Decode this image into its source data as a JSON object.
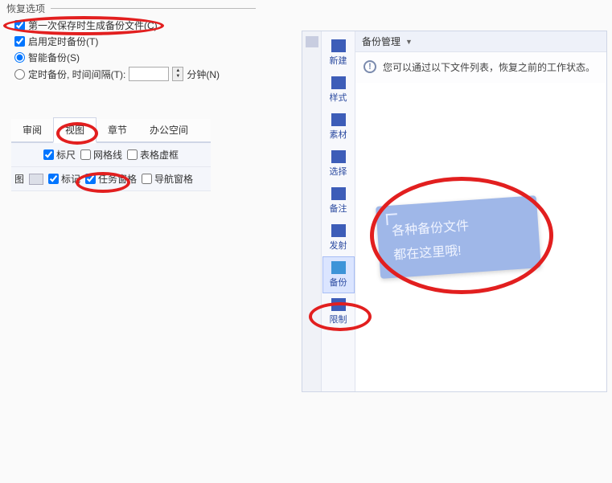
{
  "recovery": {
    "group_title": "恢复选项",
    "opt_first_save": "第一次保存时生成备份文件(C)",
    "opt_enable_timed": "启用定时备份(T)",
    "opt_smart": "智能备份(S)",
    "opt_interval": "定时备份, 时间间隔(T):",
    "unit": "分钟(N)"
  },
  "tabs": {
    "review": "审阅",
    "view": "视图",
    "chapter": "章节",
    "office": "办公空间"
  },
  "ribbon": {
    "ruler": "标尺",
    "gridlines": "网格线",
    "table_frame": "表格虚框",
    "marker": "标记",
    "task_pane": "任务窗格",
    "nav_pane": "导航窗格",
    "row2_prefix": "图"
  },
  "vtoolbar": {
    "new": "新建",
    "style": "样式",
    "material": "素材",
    "select": "选择",
    "note": "备注",
    "send": "发射",
    "backup": "备份",
    "limit": "限制"
  },
  "panel": {
    "title": "备份管理",
    "info": "您可以通过以下文件列表，恢复之前的工作状态。"
  },
  "note_card": {
    "line1": "各种备份文件",
    "line2": "都在这里哦!"
  }
}
